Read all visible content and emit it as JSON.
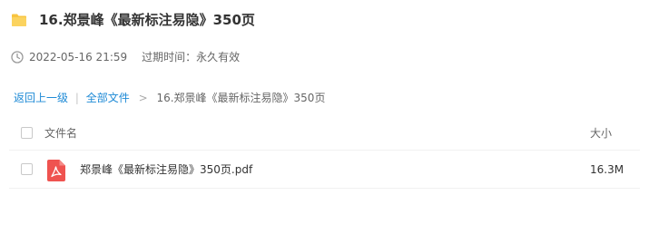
{
  "header": {
    "title": "16.郑景峰《最新标注易隐》350页",
    "folder_icon": "folder-icon",
    "folder_color": "#f8c440"
  },
  "meta": {
    "clock_icon": "clock-icon",
    "timestamp": "2022-05-16 21:59",
    "expire_text": "过期时间：永久有效"
  },
  "breadcrumb": {
    "back_label": "返回上一级",
    "separator": "|",
    "all_files_label": "全部文件",
    "arrow": ">",
    "current": "16.郑景峰《最新标注易隐》350页"
  },
  "table": {
    "columns": {
      "name": "文件名",
      "size": "大小"
    },
    "rows": [
      {
        "icon": "pdf-icon",
        "icon_color": "#ef5350",
        "name": "郑景峰《最新标注易隐》350页.pdf",
        "size": "16.3M"
      }
    ]
  },
  "colors": {
    "link": "#1e8ad6",
    "text": "#333333",
    "muted": "#666666"
  }
}
